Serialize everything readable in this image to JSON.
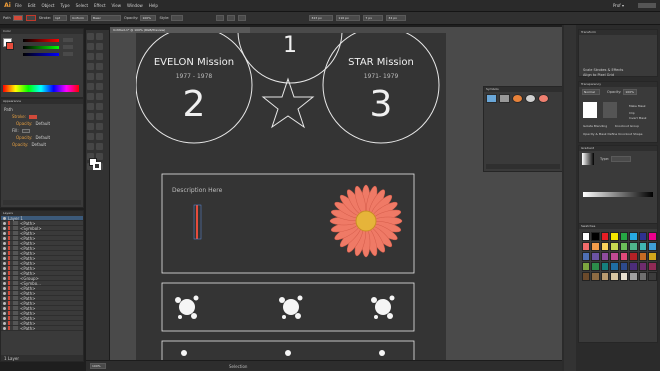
{
  "app": {
    "logo": "Ai",
    "workspace": "Prof ▾"
  },
  "menu": [
    "File",
    "Edit",
    "Object",
    "Type",
    "Select",
    "Effect",
    "View",
    "Window",
    "Help"
  ],
  "control_bar": {
    "selection_label": "Path",
    "stroke_label": "Stroke:",
    "stroke_value": "1pt",
    "profile_value": "Uniform",
    "brush_value": "Basic",
    "opacity_label": "Opacity:",
    "opacity_value": "100%",
    "style_label": "Style:",
    "x_value": "323 px",
    "y_value": "116 px",
    "w_value": "7 px",
    "h_value": "34 px"
  },
  "document_tab": "Untitled-1* @ 100% (RGB/Preview)",
  "artboard": {
    "top_circle_number": "1",
    "left_circle": {
      "title": "EVELON Mission",
      "years": "1977 - 1978",
      "number": "2"
    },
    "right_circle": {
      "title": "STAR Mission",
      "years": "1971- 1979",
      "number": "3"
    },
    "description_text": "Description Here"
  },
  "status_bar": {
    "zoom": "100%",
    "tool": "Selection"
  },
  "left_panels": {
    "color_tab": "Color",
    "appearance_tab": "Appearance",
    "appearance_rows": [
      {
        "label": "Path",
        "value": ""
      },
      {
        "label": "Stroke:",
        "value": ""
      },
      {
        "label": "Opacity:",
        "value": "Default"
      },
      {
        "label": "Fill:",
        "value": ""
      },
      {
        "label": "Opacity:",
        "value": "Default"
      },
      {
        "label": "Opacity:",
        "value": "Default"
      }
    ],
    "layers_tab": "Layers",
    "layer_top": "Layer 1",
    "layer_rows": [
      "<Path>",
      "<Symbol>",
      "<Path>",
      "<Path>",
      "<Path>",
      "<Path>",
      "<Path>",
      "<Path>",
      "<Path>",
      "<Path>",
      "<Path>",
      "<Group>",
      "<Symbo...",
      "<Path>",
      "<Path>",
      "<Path>",
      "<Path>",
      "<Path>",
      "<Path>",
      "<Path>",
      "<Path>",
      "<Path>"
    ],
    "layers_footer": "1 Layer"
  },
  "symbols_panel": {
    "title": "Symbols"
  },
  "right_panels": {
    "transform_tab": "Transform",
    "scale_strokes": "Scale Strokes & Effects",
    "align_pixel": "Align to Pixel Grid",
    "transparency_tab": "Transparency",
    "blend_mode": "Normal",
    "opacity_label": "Opacity:",
    "opacity_value": "100%",
    "make_mask": "Make Mask",
    "clip": "Clip",
    "invert_mask": "Invert Mask",
    "isolate_blending": "Isolate Blending",
    "knockout_group": "Knockout Group",
    "opacity_mask": "Opacity & Mask Define Knockout Shape",
    "gradient_tab": "Gradient",
    "type_label": "Type:",
    "swatches_tab": "Swatches"
  },
  "swatch_colors": [
    "#ffffff",
    "#000000",
    "#e61e25",
    "#f5e600",
    "#26a744",
    "#27a9e1",
    "#2e3191",
    "#ec008c",
    "#f26b6b",
    "#f39c4a",
    "#fbd35b",
    "#c8d952",
    "#6cbf5a",
    "#4fb38b",
    "#40b7b3",
    "#3f9fd6",
    "#4e6fb5",
    "#6a53a3",
    "#8e4c9e",
    "#c04a93",
    "#e0497a",
    "#b22126",
    "#c66b23",
    "#d1a61c",
    "#7ca53e",
    "#2c8c4a",
    "#15807d",
    "#1f6ea3",
    "#2d4a8c",
    "#4c2d7a",
    "#6e2c6e",
    "#8f2a55",
    "#6b4a2b",
    "#8d6b43",
    "#b89a6f",
    "#d9c6a2",
    "#e8e0cf",
    "#a0a0a0",
    "#6f6f6f",
    "#3c3c3c"
  ]
}
